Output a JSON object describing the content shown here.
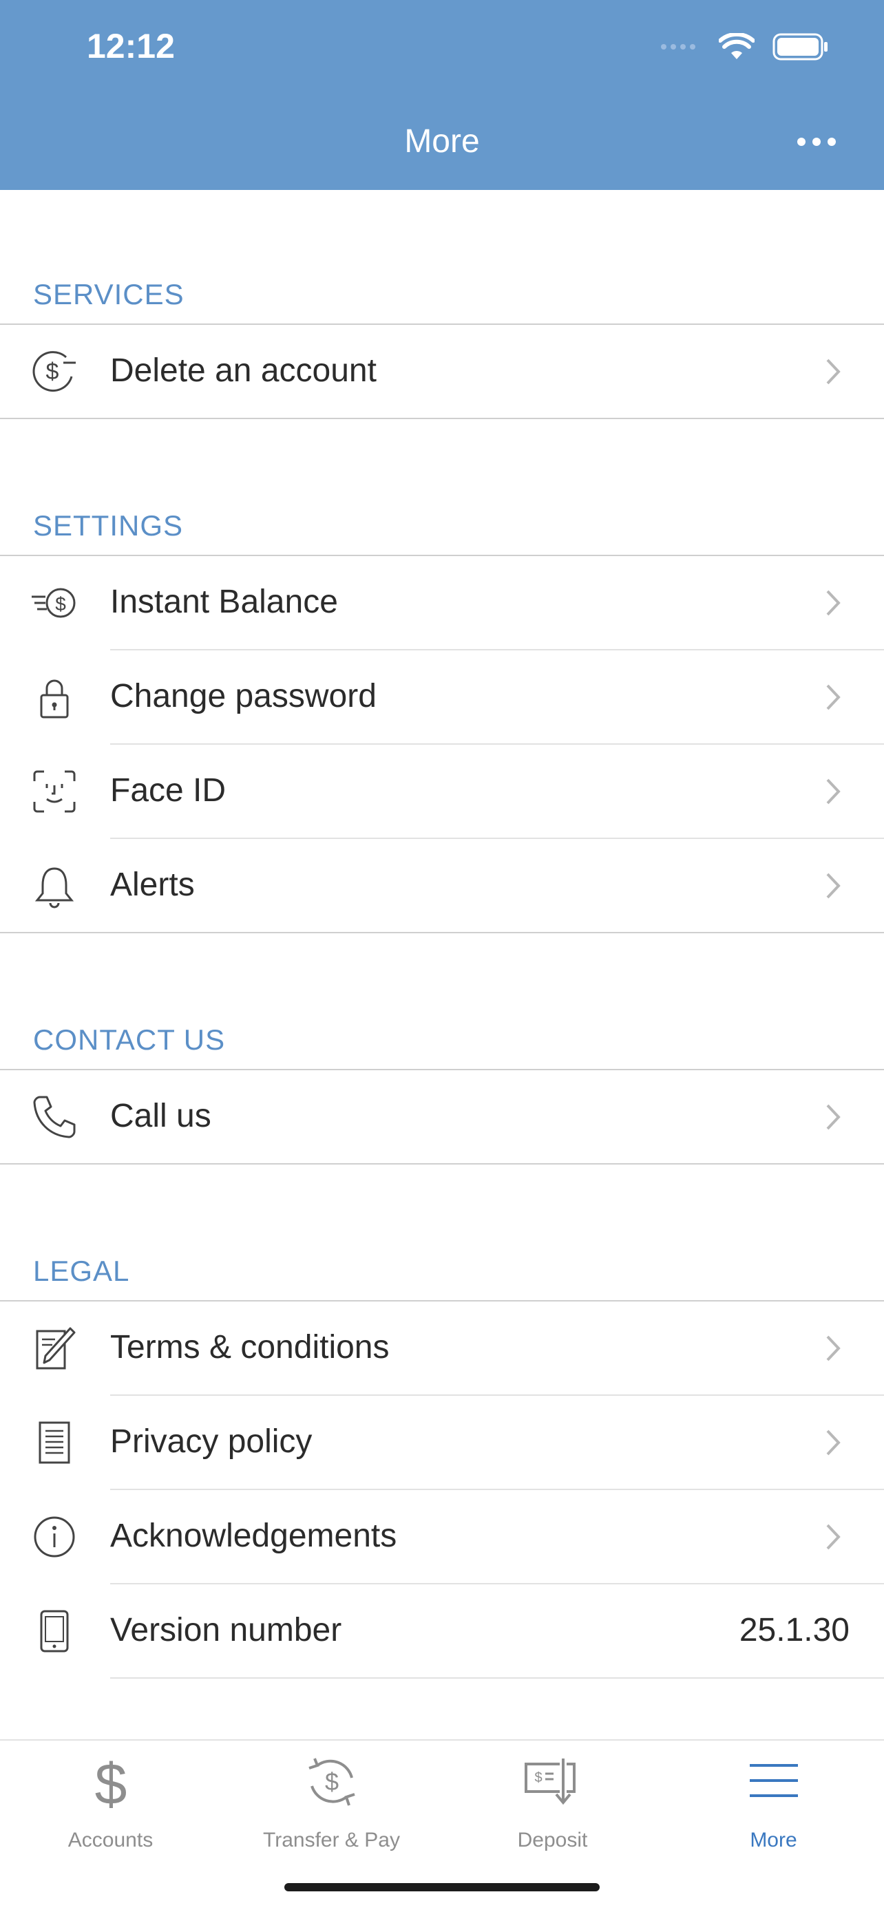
{
  "status_bar": {
    "time": "12:12"
  },
  "nav": {
    "title": "More"
  },
  "sections": {
    "services": {
      "header": "SERVICES",
      "items": [
        {
          "label": "Delete an account",
          "icon": "dollar-minus-icon"
        }
      ]
    },
    "settings": {
      "header": "SETTINGS",
      "items": [
        {
          "label": "Instant Balance",
          "icon": "instant-balance-icon"
        },
        {
          "label": "Change password",
          "icon": "lock-icon"
        },
        {
          "label": "Face ID",
          "icon": "face-id-icon"
        },
        {
          "label": "Alerts",
          "icon": "bell-icon"
        }
      ]
    },
    "contact": {
      "header": "CONTACT US",
      "items": [
        {
          "label": "Call us",
          "icon": "phone-icon"
        }
      ]
    },
    "legal": {
      "header": "LEGAL",
      "items": [
        {
          "label": "Terms & conditions",
          "icon": "document-edit-icon"
        },
        {
          "label": "Privacy policy",
          "icon": "document-icon"
        },
        {
          "label": "Acknowledgements",
          "icon": "info-icon"
        },
        {
          "label": "Version number",
          "icon": "phone-device-icon",
          "value": "25.1.30"
        }
      ]
    }
  },
  "tabbar": {
    "tabs": [
      {
        "label": "Accounts",
        "icon": "dollar-icon",
        "active": false
      },
      {
        "label": "Transfer & Pay",
        "icon": "transfer-icon",
        "active": false
      },
      {
        "label": "Deposit",
        "icon": "check-deposit-icon",
        "active": false
      },
      {
        "label": "More",
        "icon": "menu-icon",
        "active": true
      }
    ]
  },
  "colors": {
    "header": "#6699cc",
    "section_header": "#5b8fc7",
    "active_tab": "#3a78c0",
    "inactive_tab": "#8e8e8e"
  }
}
